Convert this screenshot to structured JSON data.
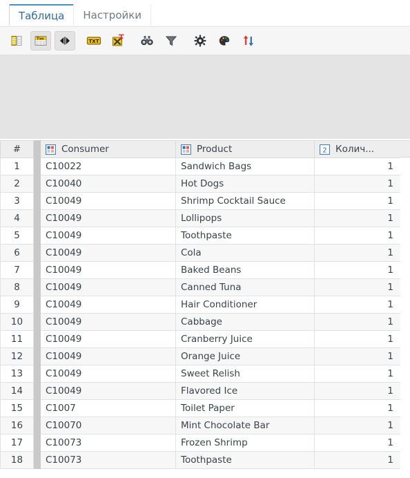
{
  "window": {
    "tabs": [
      {
        "label": "Таблица",
        "active": true
      },
      {
        "label": "Настройки",
        "active": false
      }
    ]
  },
  "toolbar": {
    "buttons": [
      {
        "name": "columns-view-icon",
        "title": "Столбцы",
        "pressed": false
      },
      {
        "name": "text-table-icon",
        "title": "Таблица текста",
        "pressed": true
      },
      {
        "name": "fit-columns-icon",
        "title": "Ширина столбцов",
        "pressed": true
      },
      {
        "name": "txt-export-icon",
        "title": "TXT",
        "pressed": false
      },
      {
        "name": "excel-export-icon",
        "title": "Экспорт в Excel",
        "pressed": false
      },
      {
        "name": "find-binoculars-icon",
        "title": "Поиск",
        "pressed": false
      },
      {
        "name": "filter-funnel-icon",
        "title": "Фильтр",
        "pressed": false
      },
      {
        "name": "gear-settings-icon",
        "title": "Настройки",
        "pressed": false
      },
      {
        "name": "palette-colors-icon",
        "title": "Цвета",
        "pressed": false
      },
      {
        "name": "sort-arrows-icon",
        "title": "Сортировка",
        "pressed": false
      }
    ]
  },
  "table": {
    "columns": [
      {
        "key": "num",
        "label": "#",
        "icon": null,
        "align": "center"
      },
      {
        "key": "consumer",
        "label": "Consumer",
        "icon": "category-icon",
        "align": "left"
      },
      {
        "key": "product",
        "label": "Product",
        "icon": "category-icon",
        "align": "left"
      },
      {
        "key": "quantity",
        "label": "Колич...",
        "icon": "numeric-2-icon",
        "align": "left"
      }
    ],
    "rows": [
      {
        "num": "1",
        "consumer": "C10022",
        "product": "Sandwich Bags",
        "quantity": "1"
      },
      {
        "num": "2",
        "consumer": "C10040",
        "product": "Hot Dogs",
        "quantity": "1"
      },
      {
        "num": "3",
        "consumer": "C10049",
        "product": "Shrimp Cocktail Sauce",
        "quantity": "1"
      },
      {
        "num": "4",
        "consumer": "C10049",
        "product": "Lollipops",
        "quantity": "1"
      },
      {
        "num": "5",
        "consumer": "C10049",
        "product": "Toothpaste",
        "quantity": "1"
      },
      {
        "num": "6",
        "consumer": "C10049",
        "product": "Cola",
        "quantity": "1"
      },
      {
        "num": "7",
        "consumer": "C10049",
        "product": "Baked Beans",
        "quantity": "1"
      },
      {
        "num": "8",
        "consumer": "C10049",
        "product": "Canned Tuna",
        "quantity": "1"
      },
      {
        "num": "9",
        "consumer": "C10049",
        "product": "Hair Conditioner",
        "quantity": "1"
      },
      {
        "num": "10",
        "consumer": "C10049",
        "product": "Cabbage",
        "quantity": "1"
      },
      {
        "num": "11",
        "consumer": "C10049",
        "product": "Cranberry Juice",
        "quantity": "1"
      },
      {
        "num": "12",
        "consumer": "C10049",
        "product": "Orange Juice",
        "quantity": "1"
      },
      {
        "num": "13",
        "consumer": "C10049",
        "product": "Sweet Relish",
        "quantity": "1"
      },
      {
        "num": "14",
        "consumer": "C10049",
        "product": "Flavored Ice",
        "quantity": "1"
      },
      {
        "num": "15",
        "consumer": "C1007",
        "product": "Toilet Paper",
        "quantity": "1"
      },
      {
        "num": "16",
        "consumer": "C10070",
        "product": "Mint Chocolate Bar",
        "quantity": "1"
      },
      {
        "num": "17",
        "consumer": "C10073",
        "product": "Frozen Shrimp",
        "quantity": "1"
      },
      {
        "num": "18",
        "consumer": "C10073",
        "product": "Toothpaste",
        "quantity": "1"
      }
    ]
  },
  "colors": {
    "accent": "#4a90c4",
    "active_tab_text": "#2d6ca2",
    "inactive_tab_text": "#707a82",
    "toolbar_bg": "#f6f6f6",
    "panel_bg": "#e4e4e4",
    "header_bg": "#eeeeee",
    "row_alt_bg": "#f7f7f7",
    "separator": "#c9c9c9",
    "icon_yellow": "#f2c21c",
    "icon_red": "#e8342a",
    "icon_blue": "#2f6fb5"
  }
}
